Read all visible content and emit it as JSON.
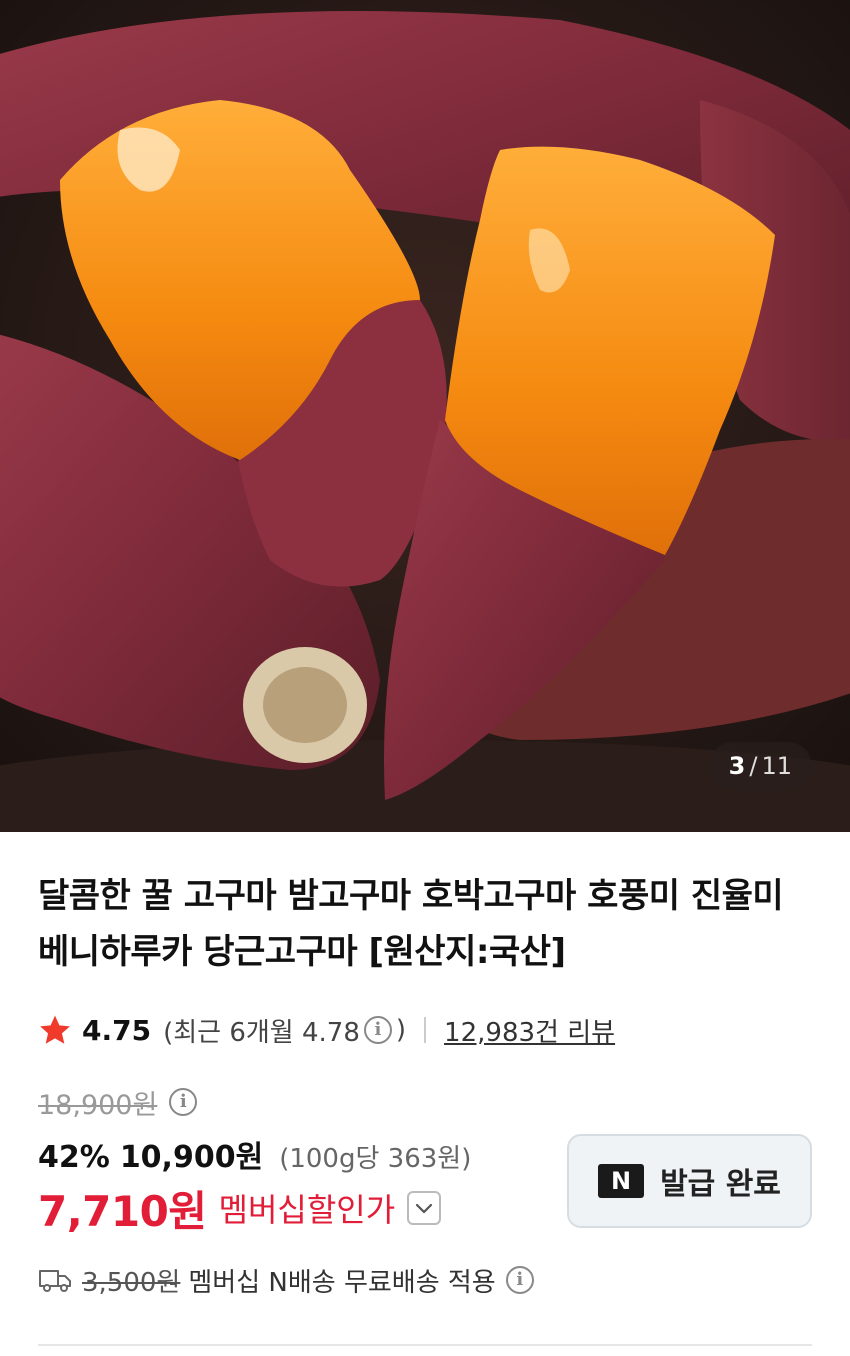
{
  "gallery": {
    "current": "3",
    "separator": "/",
    "total": "11",
    "image_icon": "sweet-potato-photo"
  },
  "product": {
    "title": "달콤한 꿀 고구마 밤고구마 호박고구마 호풍미 진율미 베니하루카 당근고구마 [원산지:국산]",
    "rating": "4.75",
    "recent_rating": "(최근 6개월 4.78",
    "recent_close": ")",
    "review_count": "12,983건 리뷰",
    "original_price": "18,900원",
    "discount_pct": "42%",
    "sale_price": "10,900원",
    "unit_price": "(100g당 363원)",
    "member_price": "7,710원",
    "member_label": "멤버십할인가"
  },
  "coupon": {
    "label": "발급 완료",
    "logo": "N"
  },
  "shipping": {
    "original_fee": "3,500원",
    "text": "멤버십 N배송 무료배송 적용"
  },
  "colors": {
    "accent_red": "#e21d38",
    "star": "#f03b2c"
  }
}
